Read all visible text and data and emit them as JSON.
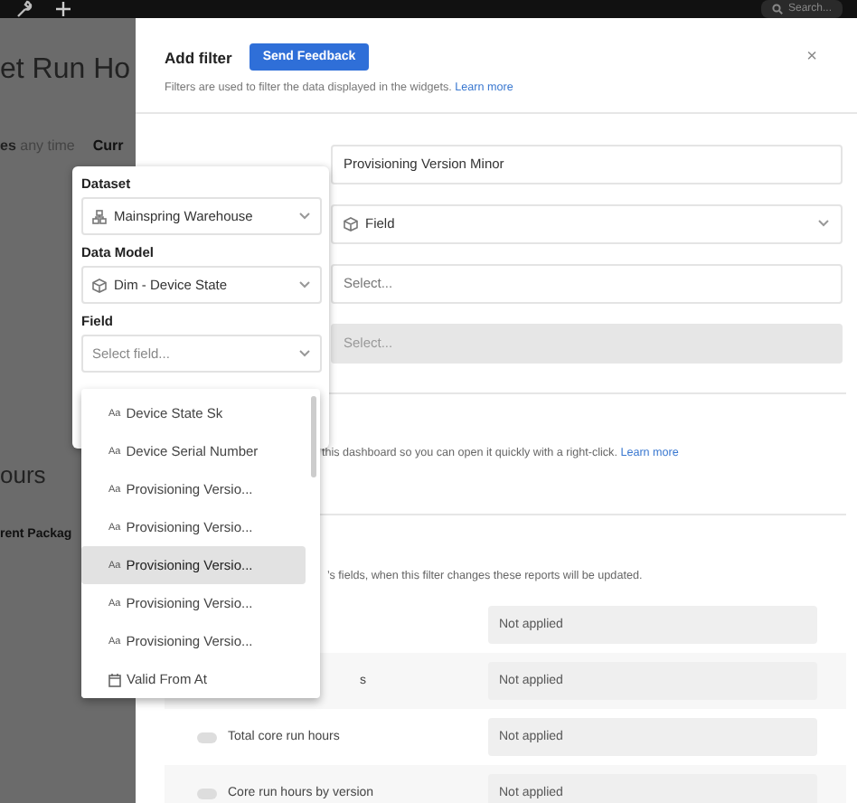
{
  "top_bar": {
    "search_placeholder": "Search..."
  },
  "background_page": {
    "title": "et Run Ho",
    "time_filter": {
      "label": "es",
      "value": "any time"
    },
    "chip": "Curr",
    "section_title": "ours",
    "subsection": "rent Packag"
  },
  "modal": {
    "title": "Add filter",
    "feedback_button": "Send Feedback",
    "close": "×",
    "description": "Filters are used to filter the data displayed in the widgets.",
    "learn_more": "Learn more",
    "fields": [
      {
        "kind": "text",
        "value": "Provisioning Version Minor"
      },
      {
        "kind": "select",
        "value": "Field",
        "disabled": false
      },
      {
        "kind": "select",
        "placeholder": "Select...",
        "disabled": false
      },
      {
        "kind": "select",
        "placeholder": "Select...",
        "disabled": true
      }
    ],
    "shortcut_note": "this dashboard so you can open it quickly with a right-click.",
    "shortcut_link": "Learn more",
    "reports_note": "’s fields, when this filter changes these reports will be updated.",
    "reports": [
      {
        "value": "Not applied"
      },
      {
        "label": "s",
        "value": "Not applied"
      },
      {
        "label": "Total core run hours",
        "toggle_on": false,
        "value": "Not applied"
      },
      {
        "label": "Core run hours by version",
        "toggle_on": false,
        "value": "Not applied"
      }
    ]
  },
  "popover": {
    "dataset_label": "Dataset",
    "dataset": "Mainspring Warehouse",
    "data_model_label": "Data Model",
    "data_model": "Dim - Device State",
    "field_label": "Field",
    "field_placeholder": "Select field...",
    "options": [
      {
        "kind": "text",
        "type_icon": "Aa",
        "label": "Device State Sk",
        "hovered": false
      },
      {
        "kind": "text",
        "type_icon": "Aa",
        "label": "Device Serial Number",
        "hovered": false
      },
      {
        "kind": "text",
        "type_icon": "Aa",
        "label": "Provisioning Versio...",
        "hovered": false
      },
      {
        "kind": "text",
        "type_icon": "Aa",
        "label": "Provisioning Versio...",
        "hovered": false
      },
      {
        "kind": "text",
        "type_icon": "Aa",
        "label": "Provisioning Versio...",
        "hovered": true
      },
      {
        "kind": "text",
        "type_icon": "Aa",
        "label": "Provisioning Versio...",
        "hovered": false
      },
      {
        "kind": "text",
        "type_icon": "Aa",
        "label": "Provisioning Versio...",
        "hovered": false
      },
      {
        "kind": "date",
        "label": "Valid From At",
        "hovered": false
      }
    ]
  }
}
